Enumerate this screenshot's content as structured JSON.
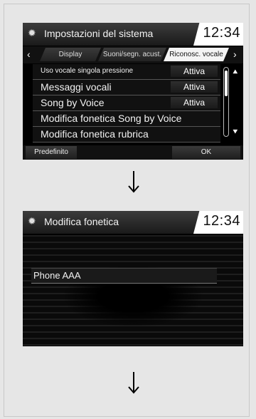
{
  "screen1": {
    "title": "Impostazioni del sistema",
    "clock": "12:34",
    "tabs": [
      {
        "label": "Display"
      },
      {
        "label": "Suoni/segn. acust."
      },
      {
        "label": "Riconosc. vocale"
      }
    ],
    "rows": [
      {
        "label": "Uso vocale singola pressione",
        "value": "Attiva"
      },
      {
        "label": "Messaggi vocali",
        "value": "Attiva"
      },
      {
        "label": "Song by Voice",
        "value": "Attiva"
      },
      {
        "label": "Modifica fonetica Song by Voice"
      },
      {
        "label": "Modifica fonetica rubrica"
      }
    ],
    "buttons": {
      "default": "Predefinito",
      "ok": "OK"
    }
  },
  "screen2": {
    "title": "Modifica fonetica",
    "clock": "12:34",
    "entry": "Phone AAA"
  }
}
